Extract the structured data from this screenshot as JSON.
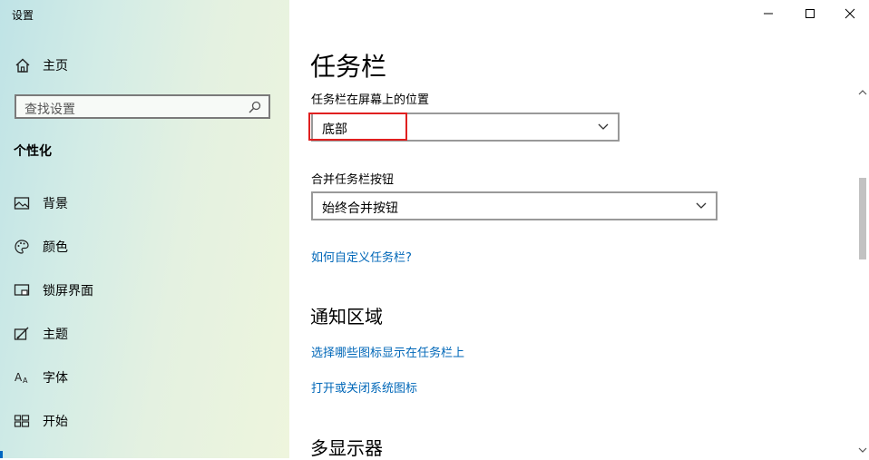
{
  "window": {
    "title": "设置"
  },
  "sidebar": {
    "home_label": "主页",
    "search_placeholder": "查找设置",
    "section_title": "个性化",
    "items": [
      {
        "label": "背景",
        "icon": "image-icon"
      },
      {
        "label": "颜色",
        "icon": "palette-icon"
      },
      {
        "label": "锁屏界面",
        "icon": "lock-screen-icon"
      },
      {
        "label": "主题",
        "icon": "theme-icon"
      },
      {
        "label": "字体",
        "icon": "font-icon"
      },
      {
        "label": "开始",
        "icon": "start-icon"
      }
    ]
  },
  "main": {
    "page_title": "任务栏",
    "position_label": "任务栏在屏幕上的位置",
    "position_value": "底部",
    "combine_label": "合并任务栏按钮",
    "combine_value": "始终合并按钮",
    "customize_link": "如何自定义任务栏?",
    "notification_heading": "通知区域",
    "select_icons_link": "选择哪些图标显示在任务栏上",
    "system_icons_link": "打开或关闭系统图标",
    "multi_display_heading": "多显示器"
  },
  "colors": {
    "accent": "#0067b8",
    "highlight_border": "#e02020"
  }
}
